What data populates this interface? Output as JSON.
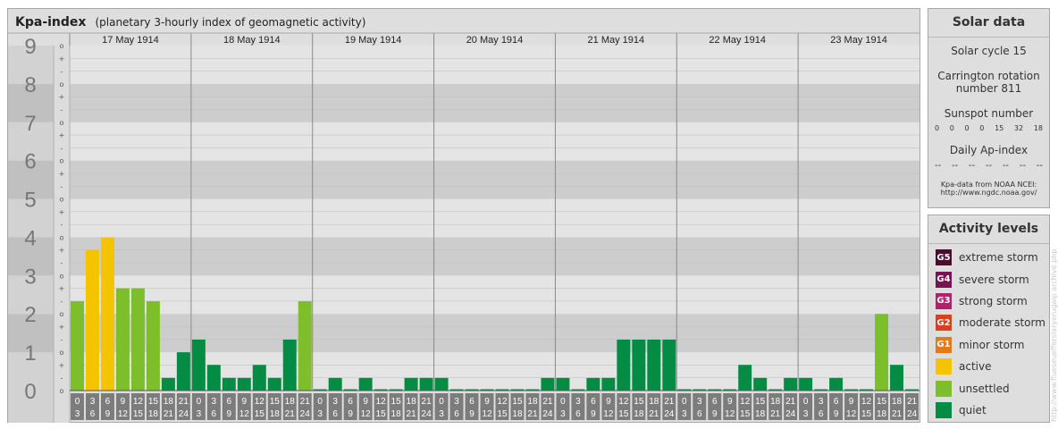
{
  "header": {
    "title": "Kpa-index",
    "subtitle": "(planetary 3-hourly index of geomagnetic activity)"
  },
  "solar": {
    "title": "Solar data",
    "cycle": "Solar cycle 15",
    "carrington_line1": "Carrington rotation",
    "carrington_line2": "number 811",
    "sunspot_label": "Sunspot number",
    "sunspot_values": [
      "0",
      "0",
      "0",
      "0",
      "15",
      "32",
      "18"
    ],
    "ap_label": "Daily Ap-index",
    "ap_values": [
      "--",
      "--",
      "--",
      "--",
      "--",
      "--",
      "--"
    ],
    "source_line1": "Kpa-data from NOAA NCEI:",
    "source_line2": "http://www.ngdc.noaa.gov/"
  },
  "activity": {
    "title": "Activity levels",
    "items": [
      {
        "code": "G5",
        "label": "extreme storm",
        "color": "#4a0d2d"
      },
      {
        "code": "G4",
        "label": "severe storm",
        "color": "#7a1450"
      },
      {
        "code": "G3",
        "label": "strong storm",
        "color": "#b5206a"
      },
      {
        "code": "G2",
        "label": "moderate storm",
        "color": "#d9401e"
      },
      {
        "code": "G1",
        "label": "minor storm",
        "color": "#e07a1c"
      },
      {
        "code": "",
        "label": "active",
        "color": "#f5c400"
      },
      {
        "code": "",
        "label": "unsettled",
        "color": "#7cbf2a"
      },
      {
        "code": "",
        "label": "quiet",
        "color": "#048c44"
      }
    ]
  },
  "credit": "http://www.flueseuefferslaryerugaip archive.php",
  "chart_data": {
    "type": "bar",
    "title": "Kpa-index",
    "ylim": [
      0,
      9
    ],
    "y_ticks": [
      "0",
      "1",
      "2",
      "3",
      "4",
      "5",
      "6",
      "7",
      "8",
      "9"
    ],
    "sub_ticks": [
      "o",
      "-",
      "+"
    ],
    "days": [
      "17 May 1914",
      "18 May 1914",
      "19 May 1914",
      "20 May 1914",
      "21 May 1914",
      "22 May 1914",
      "23 May 1914"
    ],
    "interval_start": [
      "0",
      "3",
      "6",
      "9",
      "12",
      "15",
      "18",
      "21"
    ],
    "interval_end": [
      "3",
      "6",
      "9",
      "12",
      "15",
      "18",
      "21",
      "24"
    ],
    "colors": {
      "quiet": "#048c44",
      "unsettled": "#7cbf2a",
      "active": "#f5c400"
    },
    "series": [
      {
        "values": [
          2.33,
          3.67,
          4.0,
          2.67,
          2.67,
          2.33,
          0.33,
          1.0
        ]
      },
      {
        "values": [
          1.33,
          0.67,
          0.33,
          0.33,
          0.67,
          0.33,
          1.33,
          2.33
        ]
      },
      {
        "values": [
          0.0,
          0.33,
          0.0,
          0.33,
          0.0,
          0.0,
          0.33,
          0.33
        ]
      },
      {
        "values": [
          0.33,
          0.0,
          0.0,
          0.0,
          0.0,
          0.0,
          0.0,
          0.33
        ]
      },
      {
        "values": [
          0.33,
          0.0,
          0.33,
          0.33,
          1.33,
          1.33,
          1.33,
          1.33
        ]
      },
      {
        "values": [
          0.0,
          0.0,
          0.0,
          0.0,
          0.67,
          0.33,
          0.0,
          0.33
        ]
      },
      {
        "values": [
          0.33,
          0.0,
          0.33,
          0.0,
          0.0,
          2.0,
          0.67,
          0.0
        ]
      }
    ]
  }
}
